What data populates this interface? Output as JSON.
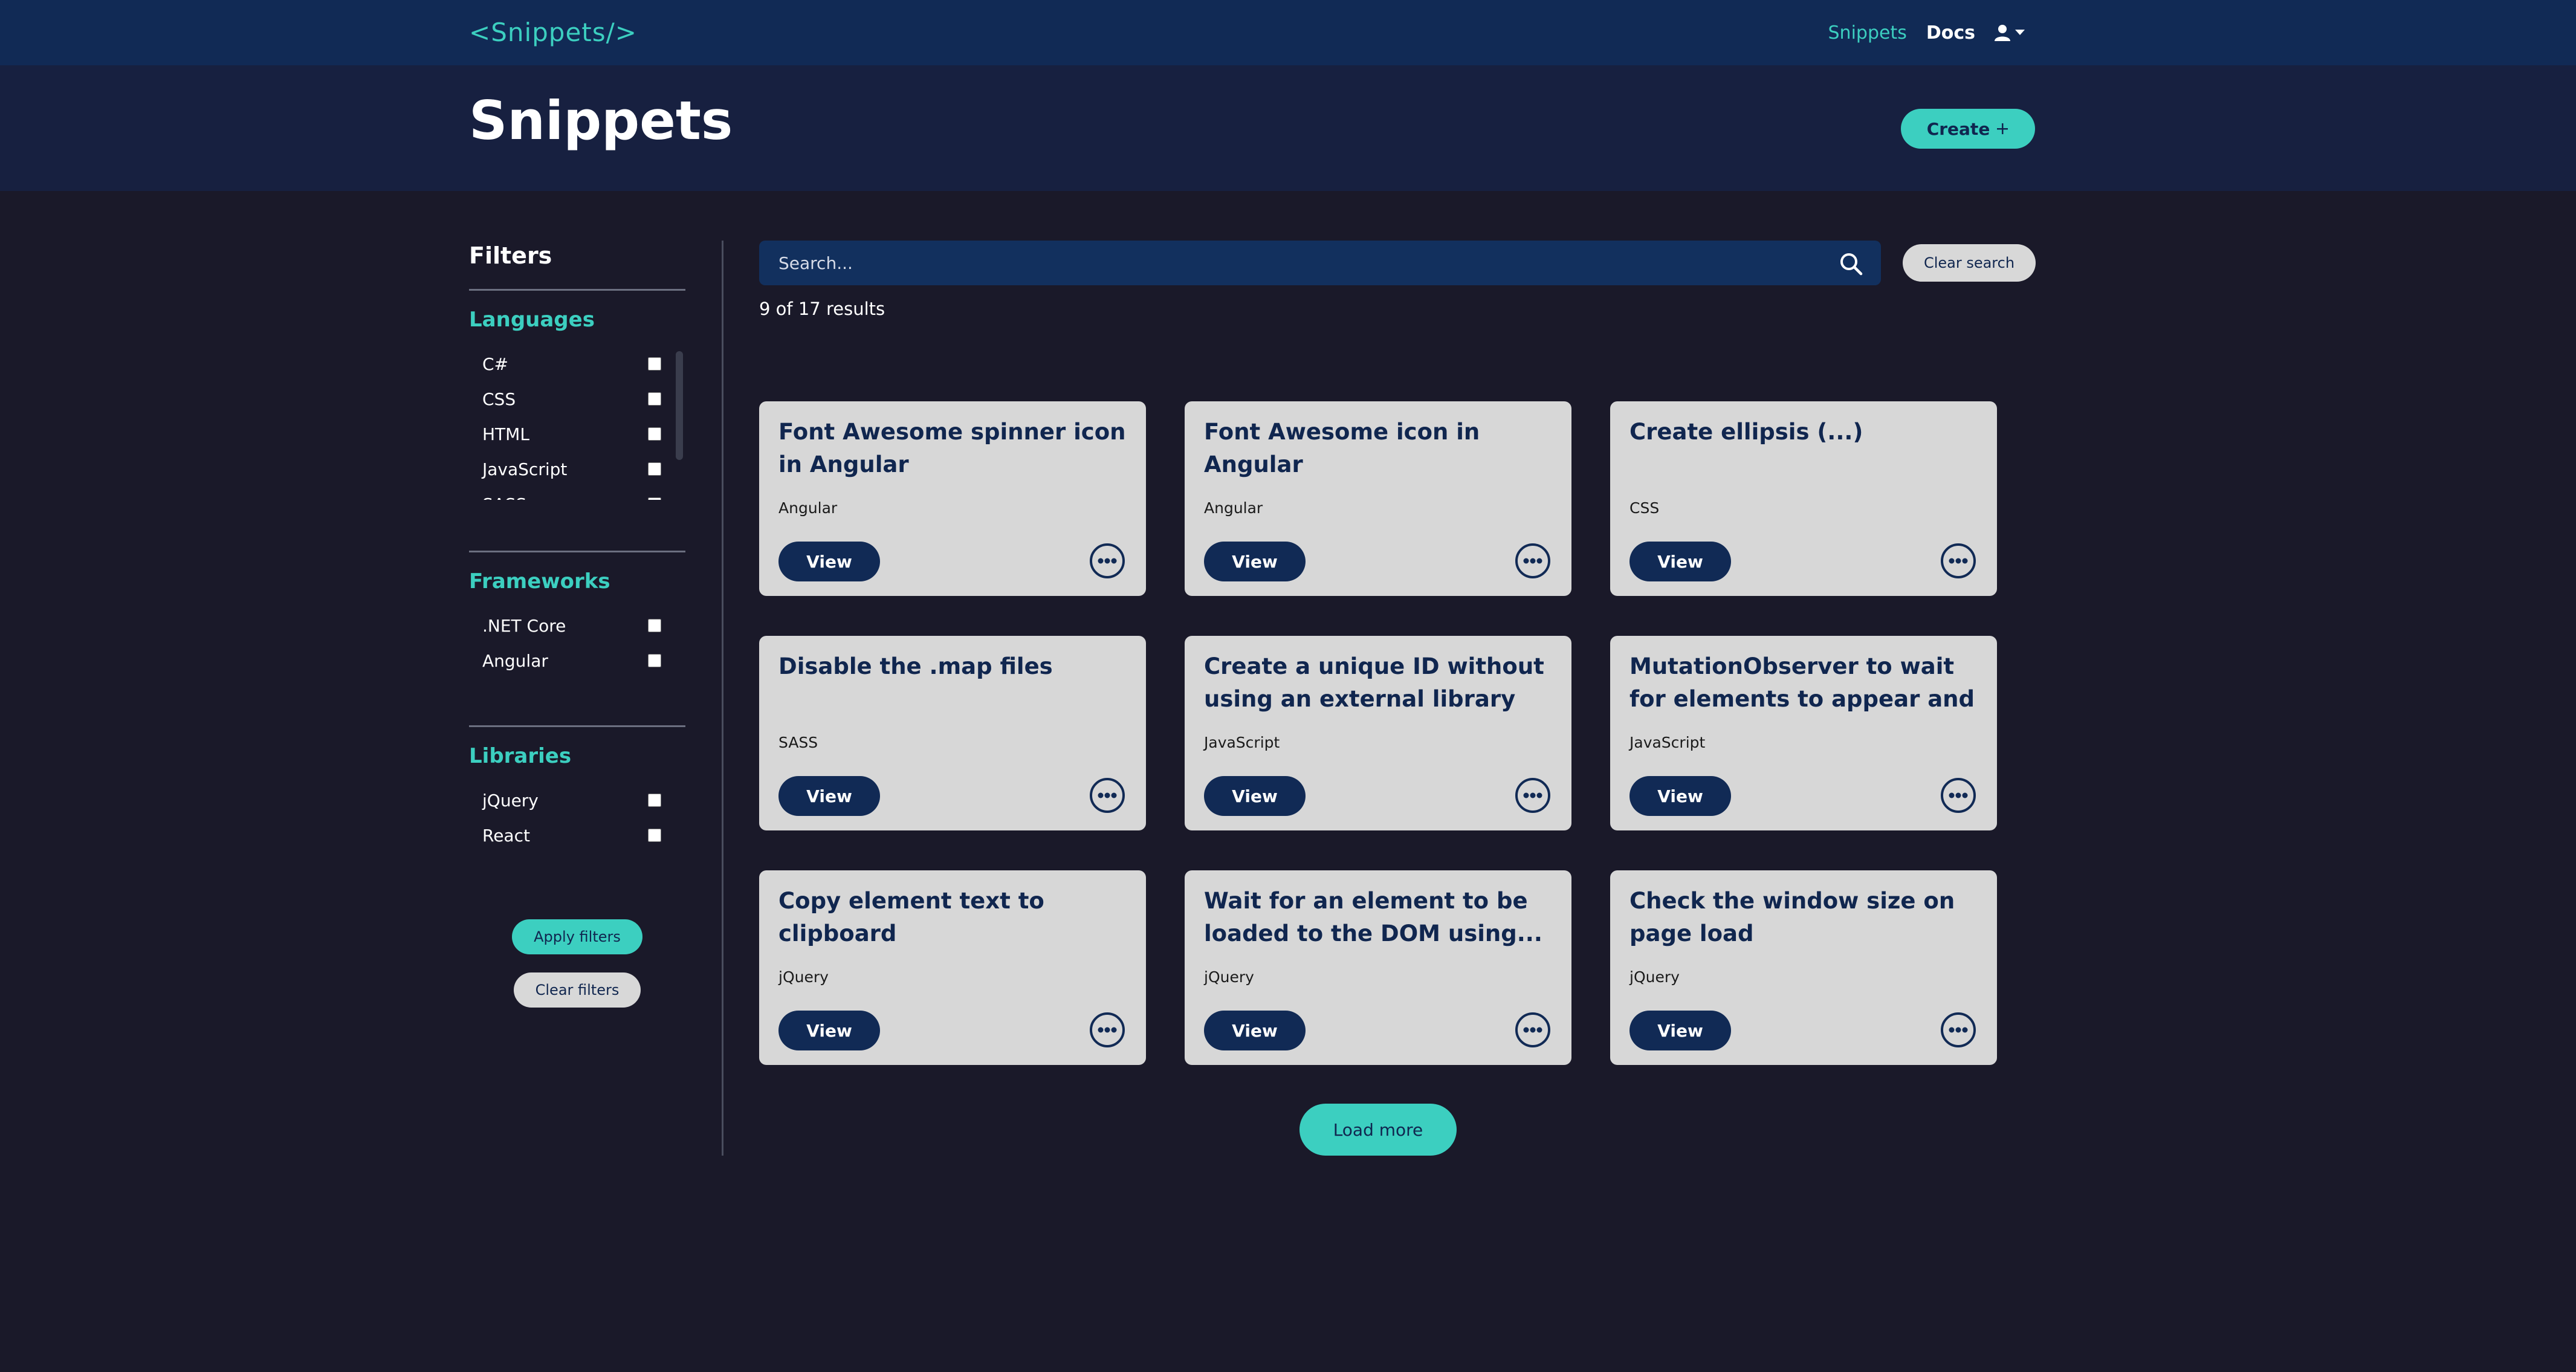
{
  "topnav": {
    "logo": "<Snippets/>",
    "links": [
      {
        "label": "Snippets"
      },
      {
        "label": "Docs"
      }
    ]
  },
  "header": {
    "title": "Snippets",
    "create_label": "Create"
  },
  "sidebar": {
    "title": "Filters",
    "groups": [
      {
        "title": "Languages",
        "options": [
          "C#",
          "CSS",
          "HTML",
          "JavaScript",
          "SASS"
        ]
      },
      {
        "title": "Frameworks",
        "options": [
          ".NET Core",
          "Angular"
        ]
      },
      {
        "title": "Libraries",
        "options": [
          "jQuery",
          "React"
        ]
      }
    ],
    "apply_label": "Apply filters",
    "clear_label": "Clear filters"
  },
  "search": {
    "placeholder": "Search...",
    "clear_label": "Clear search",
    "results_text": "9 of 17 results"
  },
  "cards": [
    {
      "title": "Font Awesome spinner icon in Angular",
      "tag": "Angular",
      "view_label": "View"
    },
    {
      "title": "Font Awesome icon in Angular",
      "tag": "Angular",
      "view_label": "View"
    },
    {
      "title": "Create ellipsis (...)",
      "tag": "CSS",
      "view_label": "View"
    },
    {
      "title": "Disable the .map files",
      "tag": "SASS",
      "view_label": "View"
    },
    {
      "title": "Create a unique ID without using an external library",
      "tag": "JavaScript",
      "view_label": "View"
    },
    {
      "title": "MutationObserver to wait for elements to appear and make...",
      "tag": "JavaScript",
      "view_label": "View"
    },
    {
      "title": "Copy element text to clipboard",
      "tag": "jQuery",
      "view_label": "View"
    },
    {
      "title": "Wait for an element to be loaded to the DOM using...",
      "tag": "jQuery",
      "view_label": "View"
    },
    {
      "title": "Check the window size on page load",
      "tag": "jQuery",
      "view_label": "View"
    }
  ],
  "load_more_label": "Load more",
  "colors": {
    "accent": "#3ccfc0",
    "navy": "#112a55",
    "background": "#1a1929",
    "card": "#d7d7d7"
  }
}
